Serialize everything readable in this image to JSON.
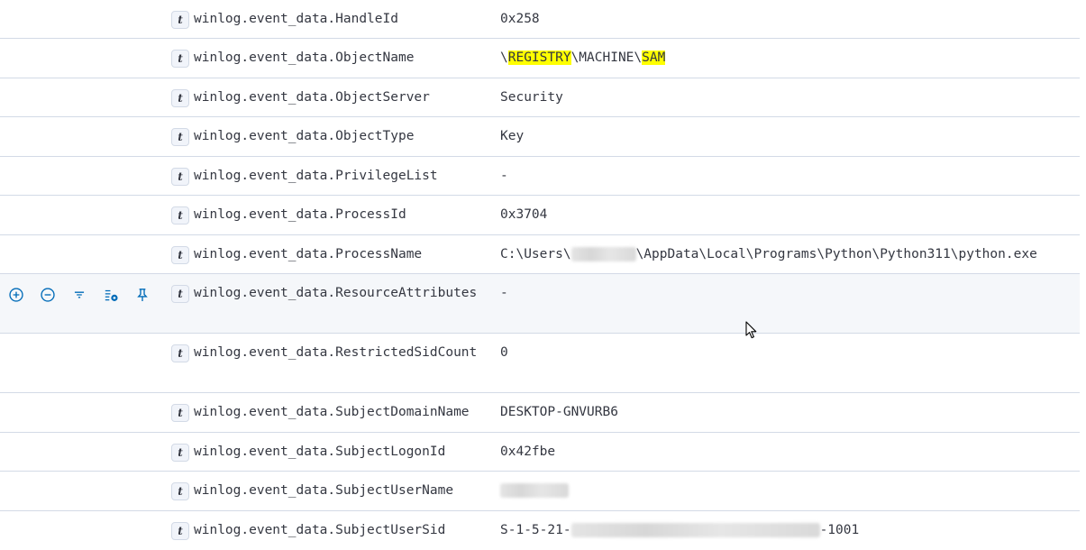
{
  "field_type_glyph": "t",
  "row_actions": [
    "filter-for-value",
    "filter-out-value",
    "toggle-column",
    "view-surrounding",
    "pin-field"
  ],
  "highlight_color": "#ffff00",
  "rows": [
    {
      "field": "winlog.event_data.HandleId",
      "value": "0x258"
    },
    {
      "field": "winlog.event_data.ObjectName",
      "value_prefix": "\\",
      "value_hl1": "REGISTRY",
      "value_mid": "\\MACHINE\\",
      "value_hl2": "SAM"
    },
    {
      "field": "winlog.event_data.ObjectServer",
      "value": "Security"
    },
    {
      "field": "winlog.event_data.ObjectType",
      "value": "Key"
    },
    {
      "field": "winlog.event_data.PrivilegeList",
      "value": "-"
    },
    {
      "field": "winlog.event_data.ProcessId",
      "value": "0x3704"
    },
    {
      "field": "winlog.event_data.ProcessName",
      "value_prefix": "C:\\Users\\",
      "value_suffix": "\\AppData\\Local\\Programs\\Python\\Python311\\python.exe"
    },
    {
      "field": "winlog.event_data.ResourceAttributes",
      "value": "-"
    },
    {
      "field": "winlog.event_data.RestrictedSidCount",
      "value": "0"
    },
    {
      "field": "winlog.event_data.SubjectDomainName",
      "value": "DESKTOP-GNVURB6"
    },
    {
      "field": "winlog.event_data.SubjectLogonId",
      "value": "0x42fbe"
    },
    {
      "field": "winlog.event_data.SubjectUserName",
      "value": ""
    },
    {
      "field": "winlog.event_data.SubjectUserSid",
      "value_prefix": "S-1-5-21-",
      "value_suffix": "-1001"
    }
  ]
}
